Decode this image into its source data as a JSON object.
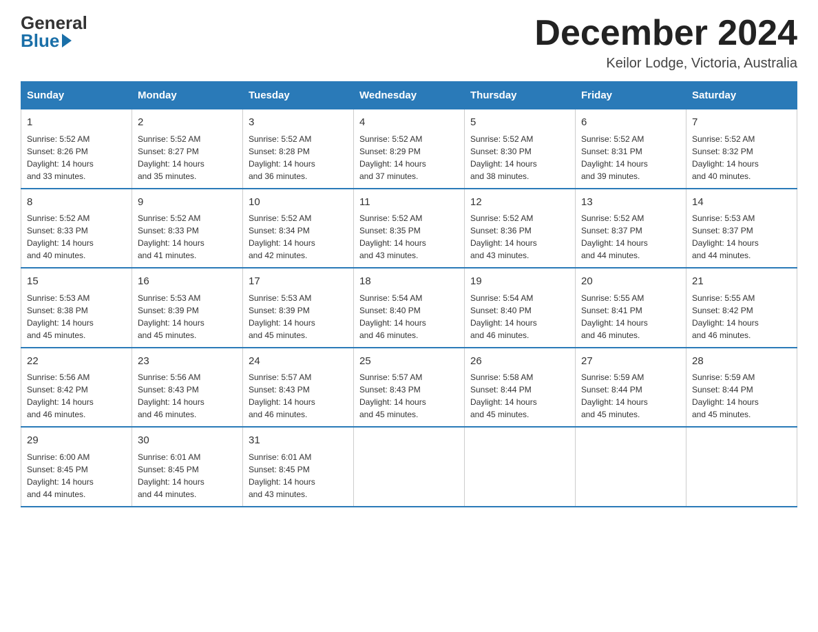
{
  "logo": {
    "general": "General",
    "blue": "Blue"
  },
  "title": "December 2024",
  "location": "Keilor Lodge, Victoria, Australia",
  "days_of_week": [
    "Sunday",
    "Monday",
    "Tuesday",
    "Wednesday",
    "Thursday",
    "Friday",
    "Saturday"
  ],
  "weeks": [
    [
      {
        "day": "1",
        "sunrise": "5:52 AM",
        "sunset": "8:26 PM",
        "daylight": "14 hours and 33 minutes."
      },
      {
        "day": "2",
        "sunrise": "5:52 AM",
        "sunset": "8:27 PM",
        "daylight": "14 hours and 35 minutes."
      },
      {
        "day": "3",
        "sunrise": "5:52 AM",
        "sunset": "8:28 PM",
        "daylight": "14 hours and 36 minutes."
      },
      {
        "day": "4",
        "sunrise": "5:52 AM",
        "sunset": "8:29 PM",
        "daylight": "14 hours and 37 minutes."
      },
      {
        "day": "5",
        "sunrise": "5:52 AM",
        "sunset": "8:30 PM",
        "daylight": "14 hours and 38 minutes."
      },
      {
        "day": "6",
        "sunrise": "5:52 AM",
        "sunset": "8:31 PM",
        "daylight": "14 hours and 39 minutes."
      },
      {
        "day": "7",
        "sunrise": "5:52 AM",
        "sunset": "8:32 PM",
        "daylight": "14 hours and 40 minutes."
      }
    ],
    [
      {
        "day": "8",
        "sunrise": "5:52 AM",
        "sunset": "8:33 PM",
        "daylight": "14 hours and 40 minutes."
      },
      {
        "day": "9",
        "sunrise": "5:52 AM",
        "sunset": "8:33 PM",
        "daylight": "14 hours and 41 minutes."
      },
      {
        "day": "10",
        "sunrise": "5:52 AM",
        "sunset": "8:34 PM",
        "daylight": "14 hours and 42 minutes."
      },
      {
        "day": "11",
        "sunrise": "5:52 AM",
        "sunset": "8:35 PM",
        "daylight": "14 hours and 43 minutes."
      },
      {
        "day": "12",
        "sunrise": "5:52 AM",
        "sunset": "8:36 PM",
        "daylight": "14 hours and 43 minutes."
      },
      {
        "day": "13",
        "sunrise": "5:52 AM",
        "sunset": "8:37 PM",
        "daylight": "14 hours and 44 minutes."
      },
      {
        "day": "14",
        "sunrise": "5:53 AM",
        "sunset": "8:37 PM",
        "daylight": "14 hours and 44 minutes."
      }
    ],
    [
      {
        "day": "15",
        "sunrise": "5:53 AM",
        "sunset": "8:38 PM",
        "daylight": "14 hours and 45 minutes."
      },
      {
        "day": "16",
        "sunrise": "5:53 AM",
        "sunset": "8:39 PM",
        "daylight": "14 hours and 45 minutes."
      },
      {
        "day": "17",
        "sunrise": "5:53 AM",
        "sunset": "8:39 PM",
        "daylight": "14 hours and 45 minutes."
      },
      {
        "day": "18",
        "sunrise": "5:54 AM",
        "sunset": "8:40 PM",
        "daylight": "14 hours and 46 minutes."
      },
      {
        "day": "19",
        "sunrise": "5:54 AM",
        "sunset": "8:40 PM",
        "daylight": "14 hours and 46 minutes."
      },
      {
        "day": "20",
        "sunrise": "5:55 AM",
        "sunset": "8:41 PM",
        "daylight": "14 hours and 46 minutes."
      },
      {
        "day": "21",
        "sunrise": "5:55 AM",
        "sunset": "8:42 PM",
        "daylight": "14 hours and 46 minutes."
      }
    ],
    [
      {
        "day": "22",
        "sunrise": "5:56 AM",
        "sunset": "8:42 PM",
        "daylight": "14 hours and 46 minutes."
      },
      {
        "day": "23",
        "sunrise": "5:56 AM",
        "sunset": "8:43 PM",
        "daylight": "14 hours and 46 minutes."
      },
      {
        "day": "24",
        "sunrise": "5:57 AM",
        "sunset": "8:43 PM",
        "daylight": "14 hours and 46 minutes."
      },
      {
        "day": "25",
        "sunrise": "5:57 AM",
        "sunset": "8:43 PM",
        "daylight": "14 hours and 45 minutes."
      },
      {
        "day": "26",
        "sunrise": "5:58 AM",
        "sunset": "8:44 PM",
        "daylight": "14 hours and 45 minutes."
      },
      {
        "day": "27",
        "sunrise": "5:59 AM",
        "sunset": "8:44 PM",
        "daylight": "14 hours and 45 minutes."
      },
      {
        "day": "28",
        "sunrise": "5:59 AM",
        "sunset": "8:44 PM",
        "daylight": "14 hours and 45 minutes."
      }
    ],
    [
      {
        "day": "29",
        "sunrise": "6:00 AM",
        "sunset": "8:45 PM",
        "daylight": "14 hours and 44 minutes."
      },
      {
        "day": "30",
        "sunrise": "6:01 AM",
        "sunset": "8:45 PM",
        "daylight": "14 hours and 44 minutes."
      },
      {
        "day": "31",
        "sunrise": "6:01 AM",
        "sunset": "8:45 PM",
        "daylight": "14 hours and 43 minutes."
      },
      null,
      null,
      null,
      null
    ]
  ],
  "labels": {
    "sunrise": "Sunrise:",
    "sunset": "Sunset:",
    "daylight": "Daylight:"
  }
}
